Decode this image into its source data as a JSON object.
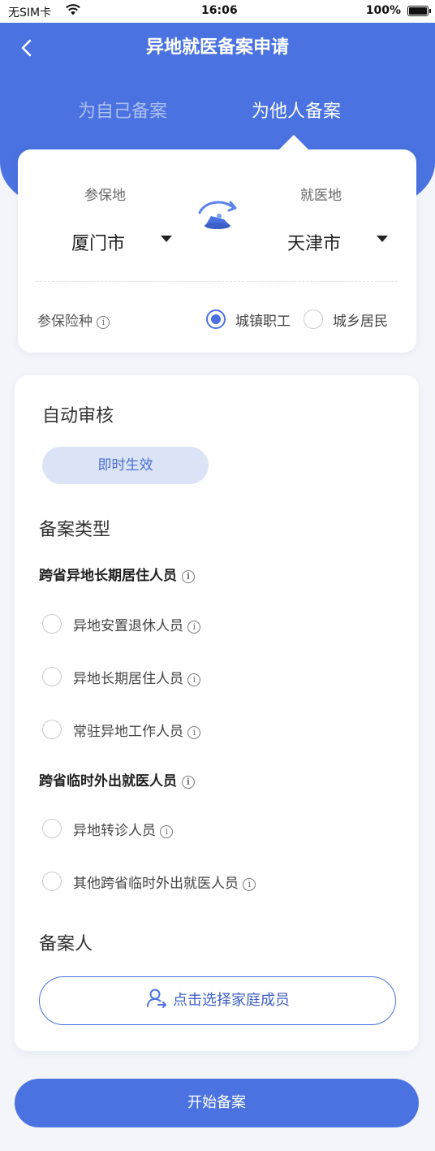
{
  "status_bar": {
    "carrier": "无SIM卡",
    "time": "16:06",
    "battery": "100%"
  },
  "header": {
    "title": "异地就医备案申请",
    "tabs": [
      {
        "label": "为自己备案",
        "active": false
      },
      {
        "label": "为他人备案",
        "active": true
      }
    ]
  },
  "location": {
    "insured_label": "参保地",
    "insured_value": "厦门市",
    "treatment_label": "就医地",
    "treatment_value": "天津市",
    "insurance_type_label": "参保险种",
    "insurance_options": [
      {
        "label": "城镇职工",
        "selected": true
      },
      {
        "label": "城乡居民",
        "selected": false
      }
    ]
  },
  "review": {
    "title": "自动审核",
    "badge": "即时生效"
  },
  "filing_type": {
    "title": "备案类型",
    "groups": [
      {
        "title": "跨省异地长期居住人员",
        "options": [
          "异地安置退休人员",
          "异地长期居住人员",
          "常驻异地工作人员"
        ]
      },
      {
        "title": "跨省临时外出就医人员",
        "options": [
          "异地转诊人员",
          "其他跨省临时外出就医人员"
        ]
      }
    ]
  },
  "filer": {
    "title": "备案人",
    "button_label": "点击选择家庭成员"
  },
  "start_button": "开始备案",
  "colors": {
    "primary": "#4a72e0",
    "badge_bg": "#dbe3f7",
    "page_bg": "#f3f5fa"
  },
  "icons": {
    "info": "ⓘ",
    "back": "chevron-left-icon",
    "swap": "swap-location-icon",
    "person": "person-add-icon"
  }
}
